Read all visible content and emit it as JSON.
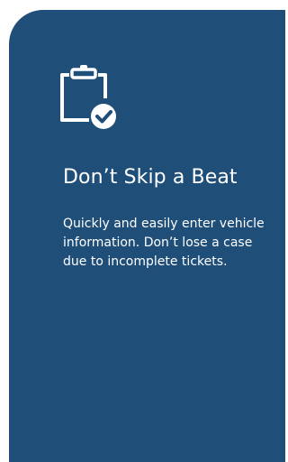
{
  "card": {
    "background_color": "#1f4e79",
    "icon": "clipboard-check-icon",
    "title": "Don’t Skip a Beat",
    "description": "Quickly and easily enter vehicle information. Don’t lose a case due to incomplete tickets."
  }
}
